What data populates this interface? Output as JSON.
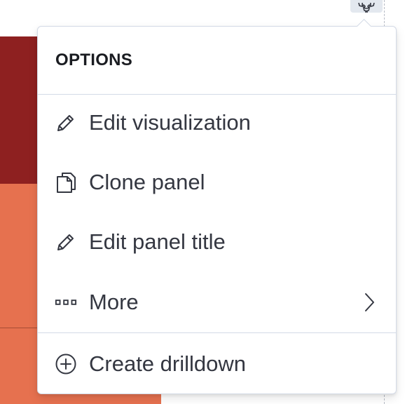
{
  "popover": {
    "title": "OPTIONS",
    "items": [
      {
        "label": "Edit visualization",
        "icon": "pencil-icon"
      },
      {
        "label": "Clone panel",
        "icon": "copy-icon"
      },
      {
        "label": "Edit panel title",
        "icon": "pencil-icon"
      },
      {
        "label": "More",
        "icon": "more-dots-icon",
        "has_submenu": true
      }
    ],
    "footer_items": [
      {
        "label": "Create drilldown",
        "icon": "plus-circle-icon"
      }
    ]
  },
  "toolbar": {
    "gear_icon": "gear-icon"
  },
  "colors": {
    "panel_dark": "#8e2020",
    "panel_light": "#e6714f",
    "text": "#343741",
    "title": "#1a1c21",
    "border": "#d3dae6"
  }
}
